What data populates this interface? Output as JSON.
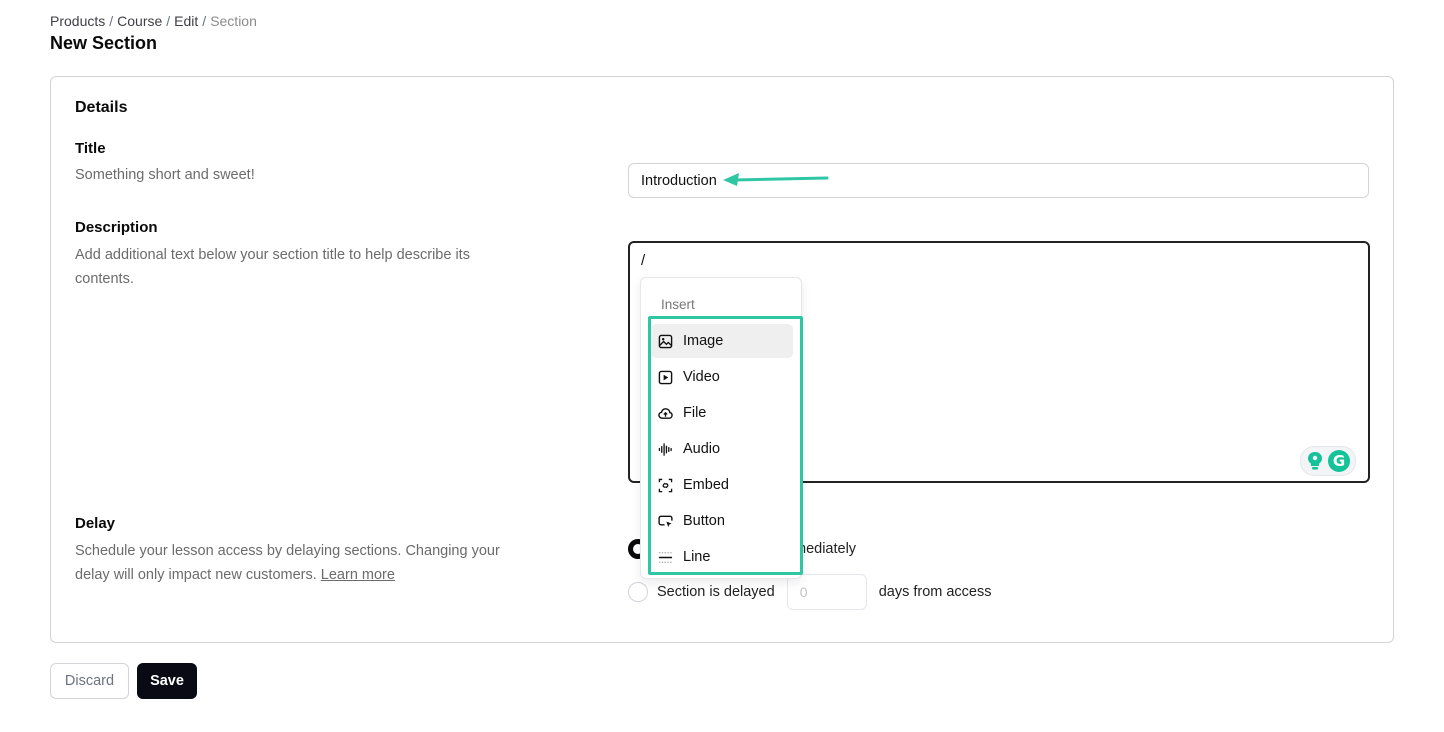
{
  "breadcrumb": {
    "items": [
      "Products",
      "Course",
      "Edit"
    ],
    "current": "Section"
  },
  "page_title": "New Section",
  "details": {
    "heading": "Details",
    "title_field": {
      "label": "Title",
      "help": "Something short and sweet!",
      "value": "Introduction"
    },
    "description_field": {
      "label": "Description",
      "help": "Add additional text below your section title to help describe its contents.",
      "value": "/"
    },
    "delay_field": {
      "label": "Delay",
      "help": "Schedule your lesson access by delaying sections. Changing your delay will only impact new customers.",
      "learn_more": "Learn more",
      "option_immediate_visible": "mediately",
      "option_delayed": "Section is delayed",
      "days_placeholder": "0",
      "days_suffix": "days from access"
    }
  },
  "insert_menu": {
    "header": "Insert",
    "items": [
      {
        "label": "Image",
        "icon": "image-icon"
      },
      {
        "label": "Video",
        "icon": "video-icon"
      },
      {
        "label": "File",
        "icon": "cloud-upload-icon"
      },
      {
        "label": "Audio",
        "icon": "audio-wave-icon"
      },
      {
        "label": "Embed",
        "icon": "embed-icon"
      },
      {
        "label": "Button",
        "icon": "button-cursor-icon"
      },
      {
        "label": "Line",
        "icon": "line-icon"
      }
    ]
  },
  "actions": {
    "discard": "Discard",
    "save": "Save"
  },
  "colors": {
    "annotation": "#2fc7a3",
    "grammarly": "#15c39a"
  }
}
